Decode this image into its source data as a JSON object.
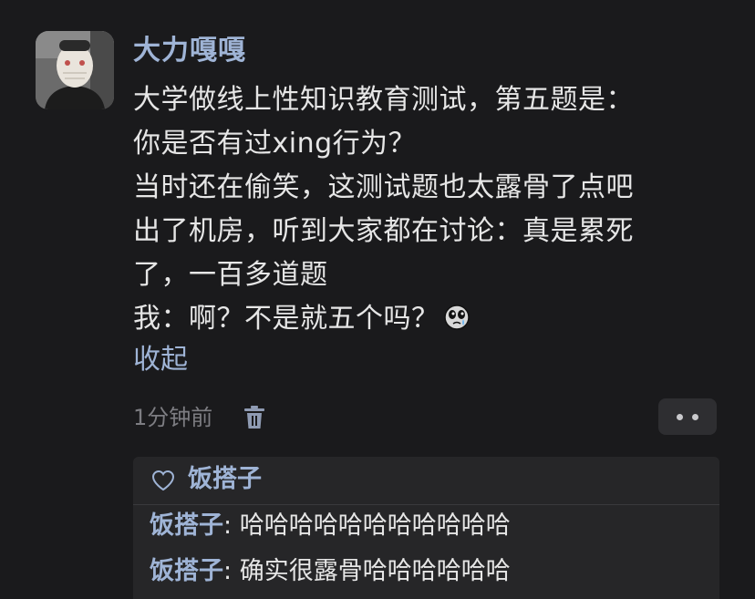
{
  "post": {
    "username": "大力嘎嘎",
    "lines": [
      "大学做线上性知识教育测试，第五题是：",
      "你是否有过xing行为？",
      "当时还在偷笑，这测试题也太露骨了点吧",
      "出了机房，听到大家都在讨论：真是累死",
      "了，一百多道题",
      "我：啊？不是就五个吗？"
    ],
    "emoji_icon": "crying-face-emoji",
    "collapse_label": "收起",
    "timestamp": "1分钟前"
  },
  "reply_section": {
    "likes": {
      "icon": "heart-outline-icon",
      "names": "饭搭子"
    },
    "comments": [
      {
        "author": "饭搭子",
        "separator": ":",
        "text": " 哈哈哈哈哈哈哈哈哈哈哈"
      },
      {
        "author": "饭搭子",
        "separator": ":",
        "text": " 确实很露骨哈哈哈哈哈哈"
      }
    ]
  },
  "colors": {
    "background": "#1a1a1c",
    "link_blue": "#9fb4d6",
    "text": "#e6e6e6",
    "muted": "#7d7d82",
    "panel": "#262628"
  }
}
